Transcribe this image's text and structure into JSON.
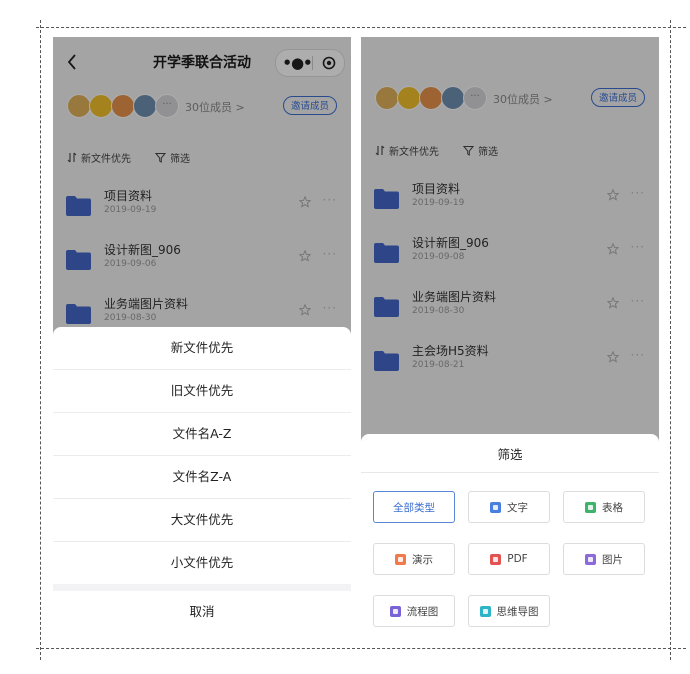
{
  "nav": {
    "title": "开学季联合活动"
  },
  "members": {
    "count_text": "30位成员 >",
    "invite_label": "邀请成员"
  },
  "toolbar": {
    "sort_label": "新文件优先",
    "filter_label": "筛选"
  },
  "files_left": [
    {
      "name": "项目资料",
      "date": "2019-09-19"
    },
    {
      "name": "设计新图_906",
      "date": "2019-09-06"
    },
    {
      "name": "业务端图片资料",
      "date": "2019-08-30"
    }
  ],
  "files_right": [
    {
      "name": "项目资料",
      "date": "2019-09-19"
    },
    {
      "name": "设计新图_906",
      "date": "2019-09-08"
    },
    {
      "name": "业务端图片资料",
      "date": "2019-08-30"
    },
    {
      "name": "主会场H5资料",
      "date": "2019-08-21"
    }
  ],
  "sort_sheet": {
    "options": [
      "新文件优先",
      "旧文件优先",
      "文件名A-Z",
      "文件名Z-A",
      "大文件优先",
      "小文件优先"
    ],
    "cancel_label": "取消"
  },
  "filter_sheet": {
    "title": "筛选",
    "types": [
      {
        "label": "全部类型",
        "icon": "none",
        "color": ""
      },
      {
        "label": "文字",
        "icon": "doc-icon",
        "color": "#4a7ee0"
      },
      {
        "label": "表格",
        "icon": "sheet-icon",
        "color": "#3fb36b"
      },
      {
        "label": "演示",
        "icon": "slides-icon",
        "color": "#f07a4b"
      },
      {
        "label": "PDF",
        "icon": "pdf-icon",
        "color": "#e45353"
      },
      {
        "label": "图片",
        "icon": "image-icon",
        "color": "#8c6ad9"
      },
      {
        "label": "流程图",
        "icon": "flowchart-icon",
        "color": "#7a63d6"
      },
      {
        "label": "思维导图",
        "icon": "mindmap-icon",
        "color": "#2db4c6"
      }
    ]
  },
  "colors": {
    "accent": "#3d6fd1",
    "folder": "#4468c8"
  }
}
